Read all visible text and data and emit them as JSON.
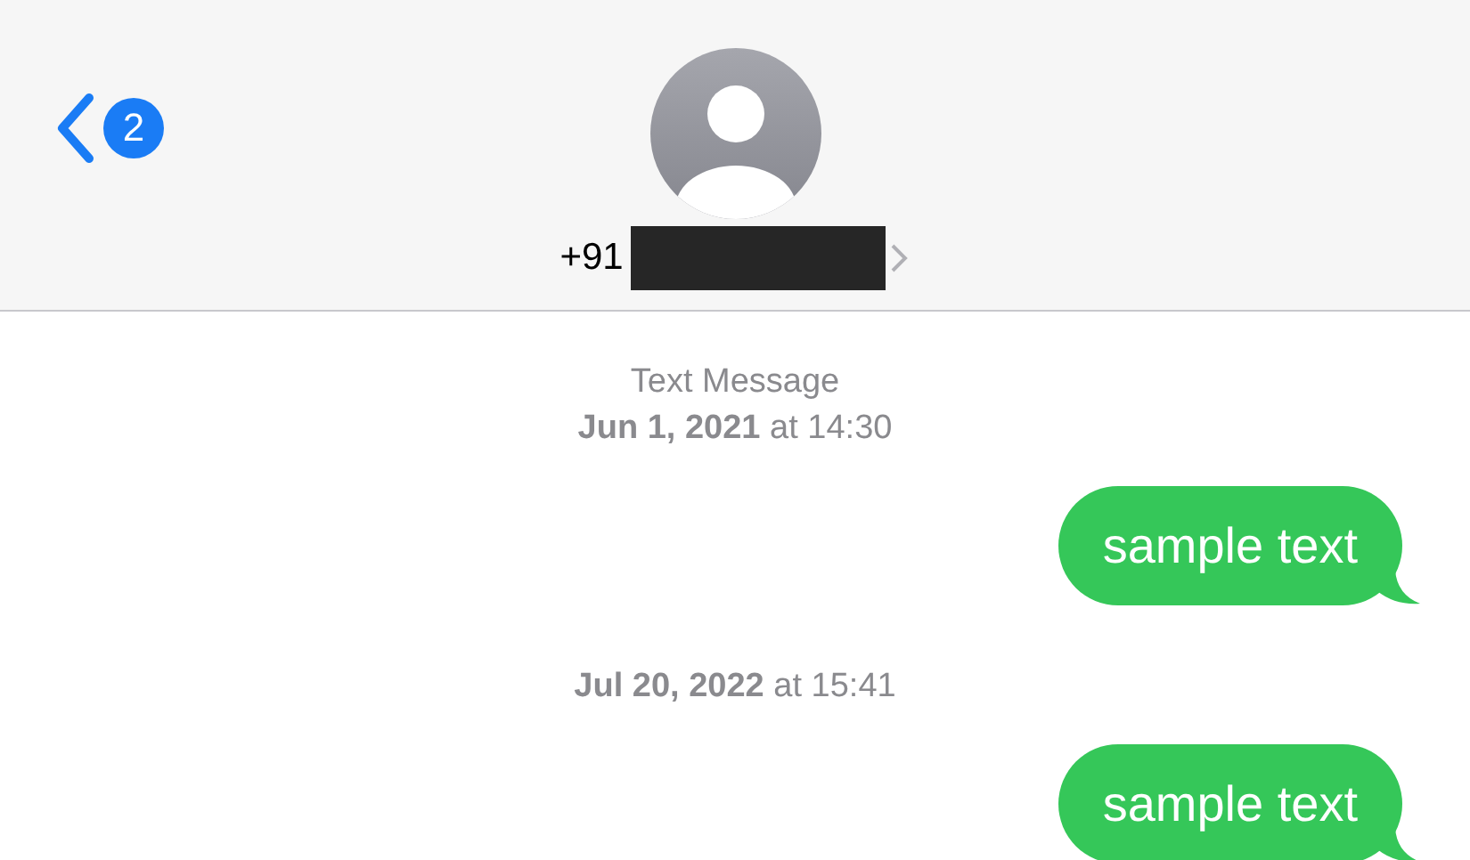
{
  "header": {
    "back_badge": "2",
    "phone_prefix": "+91"
  },
  "messages": [
    {
      "kind": "timestamp",
      "service": "Text Message",
      "time": "**Jun 1, 2021** at 14:30"
    },
    {
      "kind": "sent",
      "text": "sample text"
    },
    {
      "kind": "timestamp",
      "time": "**Jul 20, 2022** at 15:41"
    },
    {
      "kind": "sent",
      "text": "sample text"
    }
  ]
}
